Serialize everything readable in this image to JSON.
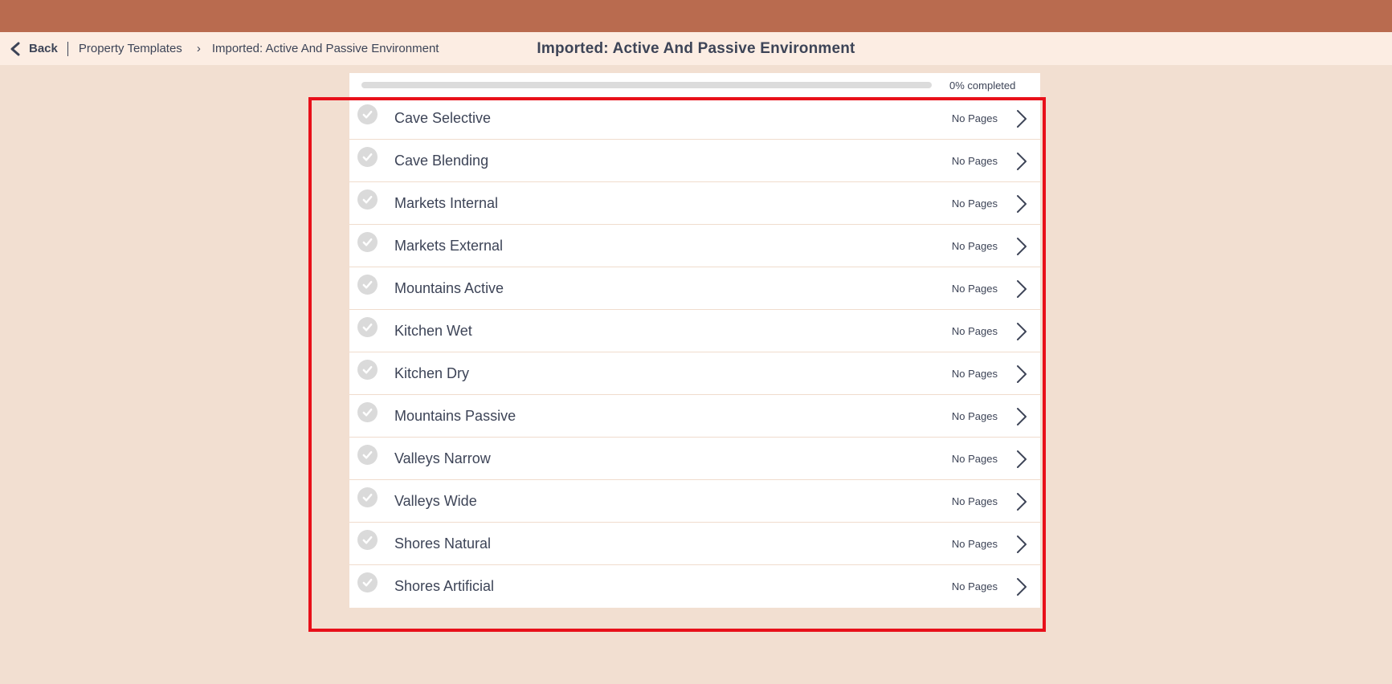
{
  "header": {
    "back_label": "Back",
    "breadcrumb": [
      "Property Templates",
      "Imported: Active And Passive Environment"
    ],
    "breadcrumb_separator": "›",
    "title": "Imported: Active And Passive Environment"
  },
  "progress": {
    "percent": 0,
    "label": "0% completed"
  },
  "sections": [
    {
      "label": "Cave Selective",
      "meta": "No Pages"
    },
    {
      "label": "Cave Blending",
      "meta": "No Pages"
    },
    {
      "label": "Markets Internal",
      "meta": "No Pages"
    },
    {
      "label": "Markets External",
      "meta": "No Pages"
    },
    {
      "label": "Mountains Active",
      "meta": "No Pages"
    },
    {
      "label": "Kitchen Wet",
      "meta": "No Pages"
    },
    {
      "label": "Kitchen Dry",
      "meta": "No Pages"
    },
    {
      "label": "Mountains Passive",
      "meta": "No Pages"
    },
    {
      "label": "Valleys Narrow",
      "meta": "No Pages"
    },
    {
      "label": "Valleys Wide",
      "meta": "No Pages"
    },
    {
      "label": "Shores Natural",
      "meta": "No Pages"
    },
    {
      "label": "Shores Artificial",
      "meta": "No Pages"
    }
  ],
  "icons": {
    "back": "chevron-left-icon",
    "row_status": "check-circle-icon",
    "row_open": "chevron-right-icon"
  },
  "colors": {
    "topbar": "#b96b4f",
    "subheader": "#fcede3",
    "background": "#f2dfd1",
    "text": "#3d4457",
    "check_circle": "#dadada",
    "highlight_frame": "#e8101a"
  }
}
